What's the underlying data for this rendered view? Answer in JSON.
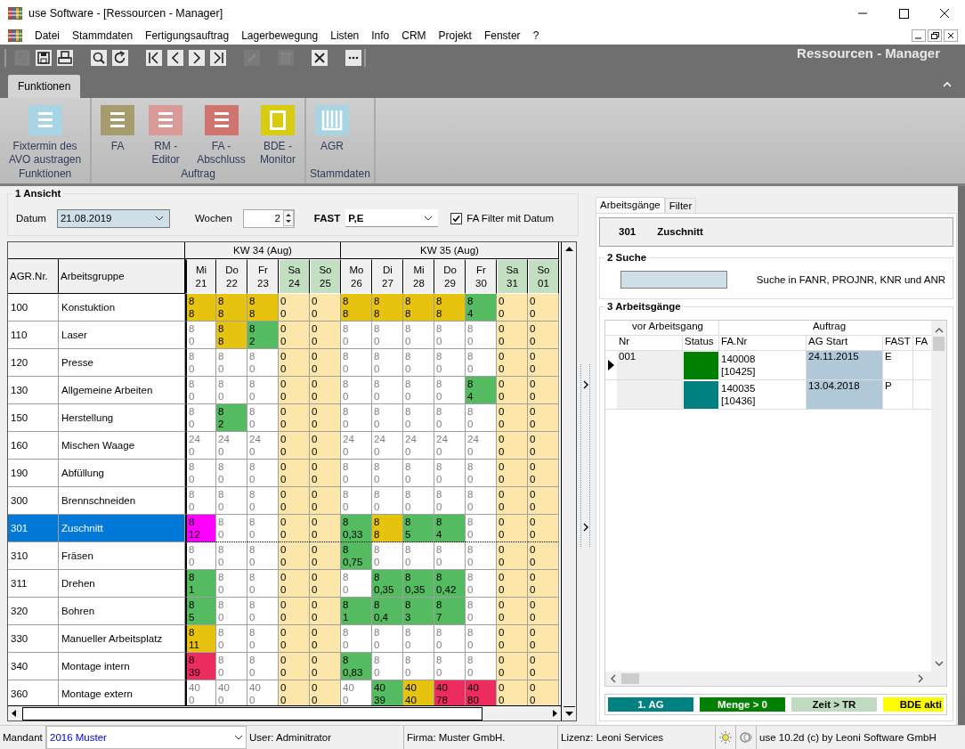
{
  "window": {
    "title": "use Software - [Ressourcen - Manager]"
  },
  "menu": [
    "Datei",
    "Stammdaten",
    "Fertigungsauftrag",
    "Lagerbewegung",
    "Listen",
    "Info",
    "CRM",
    "Projekt",
    "Fenster",
    "?"
  ],
  "toolbar": {
    "title": "Ressourcen - Manager",
    "buttons": [
      {
        "disabled": true
      },
      {
        "disabled": false
      },
      {
        "disabled": false
      },
      {
        "disabled": false
      },
      {
        "disabled": false
      },
      {
        "disabled": false
      },
      {
        "disabled": false
      },
      {
        "disabled": false
      },
      {
        "disabled": false
      },
      {
        "disabled": true
      },
      {
        "disabled": true
      },
      {
        "disabled": false
      },
      {
        "disabled": false
      }
    ]
  },
  "ribbon": {
    "tab": "Funktionen",
    "groups": [
      {
        "label": "Funktionen",
        "items": [
          {
            "label": "Fixtermin des\nAVO austragen",
            "kind": "list",
            "color": "#a8d4e4"
          }
        ]
      },
      {
        "label": "Auftrag",
        "items": [
          {
            "label": "FA",
            "kind": "list",
            "color": "#a79c6e"
          },
          {
            "label": "RM -\nEditor",
            "kind": "list",
            "color": "#d99a98"
          },
          {
            "label": "FA -\nAbschluss",
            "kind": "list",
            "color": "#d07470"
          },
          {
            "label": "BDE -\nMonitor",
            "kind": "frame",
            "color": "#d8cc10"
          }
        ]
      },
      {
        "label": "Stammdaten",
        "items": [
          {
            "label": "AGR",
            "kind": "comb",
            "color": "#a8d4e4"
          }
        ]
      }
    ]
  },
  "view": {
    "title": "1 Ansicht",
    "date_label": "Datum",
    "date": "21.08.2019",
    "weeks_label": "Wochen",
    "weeks": "2",
    "fast_label": "FAST",
    "fast": "P,E",
    "filter_label": "FA Filter mit Datum",
    "filter_checked": true
  },
  "grid": {
    "columns": [
      "AGR.Nr.",
      "Arbeitsgruppe"
    ],
    "weeks": [
      {
        "label": "KW 34 (Aug)",
        "days": [
          {
            "day": "Mi",
            "date": "21",
            "weekend": false
          },
          {
            "day": "Do",
            "date": "22",
            "weekend": false
          },
          {
            "day": "Fr",
            "date": "23",
            "weekend": false
          },
          {
            "day": "Sa",
            "date": "24",
            "weekend": true
          },
          {
            "day": "So",
            "date": "25",
            "weekend": true
          }
        ]
      },
      {
        "label": "KW 35 (Aug)",
        "days": [
          {
            "day": "Mo",
            "date": "26",
            "weekend": false
          },
          {
            "day": "Di",
            "date": "27",
            "weekend": false
          },
          {
            "day": "Mi",
            "date": "28",
            "weekend": false
          },
          {
            "day": "Do",
            "date": "29",
            "weekend": false
          },
          {
            "day": "Fr",
            "date": "30",
            "weekend": false
          },
          {
            "day": "Sa",
            "date": "31",
            "weekend": true
          },
          {
            "day": "So",
            "date": "01",
            "weekend": true
          }
        ]
      }
    ],
    "rows": [
      {
        "nr": "100",
        "name": "Konstuktion",
        "selected": false,
        "cells": [
          {
            "plan": "8",
            "used": "8",
            "color": "#e6c30f",
            "dimmed": false
          },
          {
            "plan": "8",
            "used": "8",
            "color": "#e6c30f",
            "dimmed": false
          },
          {
            "plan": "8",
            "used": "8",
            "color": "#e6c30f",
            "dimmed": false
          },
          {
            "plan": "0",
            "used": "0",
            "color": "#fde6a9",
            "dimmed": false
          },
          {
            "plan": "0",
            "used": "0",
            "color": "#fde6a9",
            "dimmed": false
          },
          {
            "plan": "8",
            "used": "8",
            "color": "#e6c30f",
            "dimmed": false
          },
          {
            "plan": "8",
            "used": "8",
            "color": "#e6c30f",
            "dimmed": false
          },
          {
            "plan": "8",
            "used": "8",
            "color": "#e6c30f",
            "dimmed": false
          },
          {
            "plan": "8",
            "used": "8",
            "color": "#e6c30f",
            "dimmed": false
          },
          {
            "plan": "8",
            "used": "4",
            "color": "#55bb60",
            "dimmed": false
          },
          {
            "plan": "0",
            "used": "0",
            "color": "#fde6a9",
            "dimmed": false
          },
          {
            "plan": "0",
            "used": "0",
            "color": "#fde6a9",
            "dimmed": false
          }
        ]
      },
      {
        "nr": "110",
        "name": "Laser",
        "selected": false,
        "cells": [
          {
            "plan": "8",
            "used": "0",
            "color": "#ffffff",
            "dimmed": true
          },
          {
            "plan": "8",
            "used": "8",
            "color": "#e6c30f",
            "dimmed": false
          },
          {
            "plan": "8",
            "used": "2",
            "color": "#55bb60",
            "dimmed": false
          },
          {
            "plan": "0",
            "used": "0",
            "color": "#fde6a9",
            "dimmed": false
          },
          {
            "plan": "0",
            "used": "0",
            "color": "#fde6a9",
            "dimmed": false
          },
          {
            "plan": "8",
            "used": "0",
            "color": "#ffffff",
            "dimmed": true
          },
          {
            "plan": "8",
            "used": "0",
            "color": "#ffffff",
            "dimmed": true
          },
          {
            "plan": "8",
            "used": "0",
            "color": "#ffffff",
            "dimmed": true
          },
          {
            "plan": "8",
            "used": "0",
            "color": "#ffffff",
            "dimmed": true
          },
          {
            "plan": "8",
            "used": "0",
            "color": "#ffffff",
            "dimmed": true
          },
          {
            "plan": "0",
            "used": "0",
            "color": "#fde6a9",
            "dimmed": false
          },
          {
            "plan": "0",
            "used": "0",
            "color": "#fde6a9",
            "dimmed": false
          }
        ]
      },
      {
        "nr": "120",
        "name": "Presse",
        "selected": false,
        "cells": [
          {
            "plan": "8",
            "used": "0",
            "color": "#ffffff",
            "dimmed": true
          },
          {
            "plan": "8",
            "used": "0",
            "color": "#ffffff",
            "dimmed": true
          },
          {
            "plan": "8",
            "used": "0",
            "color": "#ffffff",
            "dimmed": true
          },
          {
            "plan": "0",
            "used": "0",
            "color": "#fde6a9",
            "dimmed": false
          },
          {
            "plan": "0",
            "used": "0",
            "color": "#fde6a9",
            "dimmed": false
          },
          {
            "plan": "8",
            "used": "0",
            "color": "#ffffff",
            "dimmed": true
          },
          {
            "plan": "8",
            "used": "0",
            "color": "#ffffff",
            "dimmed": true
          },
          {
            "plan": "8",
            "used": "0",
            "color": "#ffffff",
            "dimmed": true
          },
          {
            "plan": "8",
            "used": "0",
            "color": "#ffffff",
            "dimmed": true
          },
          {
            "plan": "8",
            "used": "0",
            "color": "#ffffff",
            "dimmed": true
          },
          {
            "plan": "0",
            "used": "0",
            "color": "#fde6a9",
            "dimmed": false
          },
          {
            "plan": "0",
            "used": "0",
            "color": "#fde6a9",
            "dimmed": false
          }
        ]
      },
      {
        "nr": "130",
        "name": "Allgemeine Arbeiten",
        "selected": false,
        "cells": [
          {
            "plan": "8",
            "used": "0",
            "color": "#ffffff",
            "dimmed": true
          },
          {
            "plan": "8",
            "used": "0",
            "color": "#ffffff",
            "dimmed": true
          },
          {
            "plan": "8",
            "used": "0",
            "color": "#ffffff",
            "dimmed": true
          },
          {
            "plan": "0",
            "used": "0",
            "color": "#fde6a9",
            "dimmed": false
          },
          {
            "plan": "0",
            "used": "0",
            "color": "#fde6a9",
            "dimmed": false
          },
          {
            "plan": "8",
            "used": "0",
            "color": "#ffffff",
            "dimmed": true
          },
          {
            "plan": "8",
            "used": "0",
            "color": "#ffffff",
            "dimmed": true
          },
          {
            "plan": "8",
            "used": "0",
            "color": "#ffffff",
            "dimmed": true
          },
          {
            "plan": "8",
            "used": "0",
            "color": "#ffffff",
            "dimmed": true
          },
          {
            "plan": "8",
            "used": "4",
            "color": "#55bb60",
            "dimmed": false
          },
          {
            "plan": "0",
            "used": "0",
            "color": "#fde6a9",
            "dimmed": false
          },
          {
            "plan": "0",
            "used": "0",
            "color": "#fde6a9",
            "dimmed": false
          }
        ]
      },
      {
        "nr": "150",
        "name": "Herstellung",
        "selected": false,
        "cells": [
          {
            "plan": "8",
            "used": "0",
            "color": "#ffffff",
            "dimmed": true
          },
          {
            "plan": "8",
            "used": "2",
            "color": "#55bb60",
            "dimmed": false
          },
          {
            "plan": "8",
            "used": "0",
            "color": "#ffffff",
            "dimmed": true
          },
          {
            "plan": "0",
            "used": "0",
            "color": "#fde6a9",
            "dimmed": false
          },
          {
            "plan": "0",
            "used": "0",
            "color": "#fde6a9",
            "dimmed": false
          },
          {
            "plan": "8",
            "used": "0",
            "color": "#ffffff",
            "dimmed": true
          },
          {
            "plan": "8",
            "used": "0",
            "color": "#ffffff",
            "dimmed": true
          },
          {
            "plan": "8",
            "used": "0",
            "color": "#ffffff",
            "dimmed": true
          },
          {
            "plan": "8",
            "used": "0",
            "color": "#ffffff",
            "dimmed": true
          },
          {
            "plan": "8",
            "used": "0",
            "color": "#ffffff",
            "dimmed": true
          },
          {
            "plan": "0",
            "used": "0",
            "color": "#fde6a9",
            "dimmed": false
          },
          {
            "plan": "0",
            "used": "0",
            "color": "#fde6a9",
            "dimmed": false
          }
        ]
      },
      {
        "nr": "160",
        "name": "Mischen Waage",
        "selected": false,
        "cells": [
          {
            "plan": "24",
            "used": "0",
            "color": "#ffffff",
            "dimmed": true
          },
          {
            "plan": "24",
            "used": "0",
            "color": "#ffffff",
            "dimmed": true
          },
          {
            "plan": "24",
            "used": "0",
            "color": "#ffffff",
            "dimmed": true
          },
          {
            "plan": "0",
            "used": "0",
            "color": "#fde6a9",
            "dimmed": false
          },
          {
            "plan": "0",
            "used": "0",
            "color": "#fde6a9",
            "dimmed": false
          },
          {
            "plan": "24",
            "used": "0",
            "color": "#ffffff",
            "dimmed": true
          },
          {
            "plan": "24",
            "used": "0",
            "color": "#ffffff",
            "dimmed": true
          },
          {
            "plan": "24",
            "used": "0",
            "color": "#ffffff",
            "dimmed": true
          },
          {
            "plan": "24",
            "used": "0",
            "color": "#ffffff",
            "dimmed": true
          },
          {
            "plan": "24",
            "used": "0",
            "color": "#ffffff",
            "dimmed": true
          },
          {
            "plan": "0",
            "used": "0",
            "color": "#fde6a9",
            "dimmed": false
          },
          {
            "plan": "0",
            "used": "0",
            "color": "#fde6a9",
            "dimmed": false
          }
        ]
      },
      {
        "nr": "190",
        "name": "Abfüllung",
        "selected": false,
        "cells": [
          {
            "plan": "8",
            "used": "0",
            "color": "#ffffff",
            "dimmed": true
          },
          {
            "plan": "8",
            "used": "0",
            "color": "#ffffff",
            "dimmed": true
          },
          {
            "plan": "8",
            "used": "0",
            "color": "#ffffff",
            "dimmed": true
          },
          {
            "plan": "0",
            "used": "0",
            "color": "#fde6a9",
            "dimmed": false
          },
          {
            "plan": "0",
            "used": "0",
            "color": "#fde6a9",
            "dimmed": false
          },
          {
            "plan": "8",
            "used": "0",
            "color": "#ffffff",
            "dimmed": true
          },
          {
            "plan": "8",
            "used": "0",
            "color": "#ffffff",
            "dimmed": true
          },
          {
            "plan": "8",
            "used": "0",
            "color": "#ffffff",
            "dimmed": true
          },
          {
            "plan": "8",
            "used": "0",
            "color": "#ffffff",
            "dimmed": true
          },
          {
            "plan": "8",
            "used": "0",
            "color": "#ffffff",
            "dimmed": true
          },
          {
            "plan": "0",
            "used": "0",
            "color": "#fde6a9",
            "dimmed": false
          },
          {
            "plan": "0",
            "used": "0",
            "color": "#fde6a9",
            "dimmed": false
          }
        ]
      },
      {
        "nr": "300",
        "name": "Brennschneiden",
        "selected": false,
        "cells": [
          {
            "plan": "8",
            "used": "0",
            "color": "#ffffff",
            "dimmed": true
          },
          {
            "plan": "8",
            "used": "0",
            "color": "#ffffff",
            "dimmed": true
          },
          {
            "plan": "8",
            "used": "0",
            "color": "#ffffff",
            "dimmed": true
          },
          {
            "plan": "0",
            "used": "0",
            "color": "#fde6a9",
            "dimmed": false
          },
          {
            "plan": "0",
            "used": "0",
            "color": "#fde6a9",
            "dimmed": false
          },
          {
            "plan": "8",
            "used": "0",
            "color": "#ffffff",
            "dimmed": true
          },
          {
            "plan": "8",
            "used": "0",
            "color": "#ffffff",
            "dimmed": true
          },
          {
            "plan": "8",
            "used": "0",
            "color": "#ffffff",
            "dimmed": true
          },
          {
            "plan": "8",
            "used": "0",
            "color": "#ffffff",
            "dimmed": true
          },
          {
            "plan": "8",
            "used": "0",
            "color": "#ffffff",
            "dimmed": true
          },
          {
            "plan": "0",
            "used": "0",
            "color": "#fde6a9",
            "dimmed": false
          },
          {
            "plan": "0",
            "used": "0",
            "color": "#fde6a9",
            "dimmed": false
          }
        ]
      },
      {
        "nr": "301",
        "name": "Zuschnitt",
        "selected": true,
        "cells": [
          {
            "plan": "8",
            "used": "12",
            "color": "#ff00ff",
            "dimmed": false
          },
          {
            "plan": "8",
            "used": "0",
            "color": "#ffffff",
            "dimmed": true
          },
          {
            "plan": "8",
            "used": "0",
            "color": "#ffffff",
            "dimmed": true
          },
          {
            "plan": "0",
            "used": "0",
            "color": "#fde6a9",
            "dimmed": false
          },
          {
            "plan": "0",
            "used": "0",
            "color": "#fde6a9",
            "dimmed": false
          },
          {
            "plan": "8",
            "used": "0,33",
            "color": "#55bb60",
            "dimmed": false
          },
          {
            "plan": "8",
            "used": "8",
            "color": "#e6c30f",
            "dimmed": false
          },
          {
            "plan": "8",
            "used": "5",
            "color": "#55bb60",
            "dimmed": false
          },
          {
            "plan": "8",
            "used": "4",
            "color": "#55bb60",
            "dimmed": false
          },
          {
            "plan": "8",
            "used": "0",
            "color": "#ffffff",
            "dimmed": true
          },
          {
            "plan": "0",
            "used": "0",
            "color": "#fde6a9",
            "dimmed": false
          },
          {
            "plan": "0",
            "used": "0",
            "color": "#fde6a9",
            "dimmed": false
          }
        ]
      },
      {
        "nr": "310",
        "name": "Fräsen",
        "selected": false,
        "cells": [
          {
            "plan": "8",
            "used": "0",
            "color": "#ffffff",
            "dimmed": true
          },
          {
            "plan": "8",
            "used": "0",
            "color": "#ffffff",
            "dimmed": true
          },
          {
            "plan": "8",
            "used": "0",
            "color": "#ffffff",
            "dimmed": true
          },
          {
            "plan": "0",
            "used": "0",
            "color": "#fde6a9",
            "dimmed": false
          },
          {
            "plan": "0",
            "used": "0",
            "color": "#fde6a9",
            "dimmed": false
          },
          {
            "plan": "8",
            "used": "0,75",
            "color": "#55bb60",
            "dimmed": false
          },
          {
            "plan": "8",
            "used": "0",
            "color": "#ffffff",
            "dimmed": true
          },
          {
            "plan": "8",
            "used": "0",
            "color": "#ffffff",
            "dimmed": true
          },
          {
            "plan": "8",
            "used": "0",
            "color": "#ffffff",
            "dimmed": true
          },
          {
            "plan": "8",
            "used": "0",
            "color": "#ffffff",
            "dimmed": true
          },
          {
            "plan": "0",
            "used": "0",
            "color": "#fde6a9",
            "dimmed": false
          },
          {
            "plan": "0",
            "used": "0",
            "color": "#fde6a9",
            "dimmed": false
          }
        ]
      },
      {
        "nr": "311",
        "name": "Drehen",
        "selected": false,
        "cells": [
          {
            "plan": "8",
            "used": "1",
            "color": "#55bb60",
            "dimmed": false
          },
          {
            "plan": "8",
            "used": "0",
            "color": "#ffffff",
            "dimmed": true
          },
          {
            "plan": "8",
            "used": "0",
            "color": "#ffffff",
            "dimmed": true
          },
          {
            "plan": "0",
            "used": "0",
            "color": "#fde6a9",
            "dimmed": false
          },
          {
            "plan": "0",
            "used": "0",
            "color": "#fde6a9",
            "dimmed": false
          },
          {
            "plan": "8",
            "used": "0",
            "color": "#ffffff",
            "dimmed": true
          },
          {
            "plan": "8",
            "used": "0,35",
            "color": "#55bb60",
            "dimmed": false
          },
          {
            "plan": "8",
            "used": "0,35",
            "color": "#55bb60",
            "dimmed": false
          },
          {
            "plan": "8",
            "used": "0,42",
            "color": "#55bb60",
            "dimmed": false
          },
          {
            "plan": "8",
            "used": "0",
            "color": "#ffffff",
            "dimmed": true
          },
          {
            "plan": "0",
            "used": "0",
            "color": "#fde6a9",
            "dimmed": false
          },
          {
            "plan": "0",
            "used": "0",
            "color": "#fde6a9",
            "dimmed": false
          }
        ]
      },
      {
        "nr": "320",
        "name": "Bohren",
        "selected": false,
        "cells": [
          {
            "plan": "8",
            "used": "5",
            "color": "#55bb60",
            "dimmed": false
          },
          {
            "plan": "8",
            "used": "0",
            "color": "#ffffff",
            "dimmed": true
          },
          {
            "plan": "8",
            "used": "0",
            "color": "#ffffff",
            "dimmed": true
          },
          {
            "plan": "0",
            "used": "0",
            "color": "#fde6a9",
            "dimmed": false
          },
          {
            "plan": "0",
            "used": "0",
            "color": "#fde6a9",
            "dimmed": false
          },
          {
            "plan": "8",
            "used": "1",
            "color": "#55bb60",
            "dimmed": false
          },
          {
            "plan": "8",
            "used": "0,4",
            "color": "#55bb60",
            "dimmed": false
          },
          {
            "plan": "8",
            "used": "3",
            "color": "#55bb60",
            "dimmed": false
          },
          {
            "plan": "8",
            "used": "7",
            "color": "#55bb60",
            "dimmed": false
          },
          {
            "plan": "8",
            "used": "0",
            "color": "#ffffff",
            "dimmed": true
          },
          {
            "plan": "0",
            "used": "0",
            "color": "#fde6a9",
            "dimmed": false
          },
          {
            "plan": "0",
            "used": "0",
            "color": "#fde6a9",
            "dimmed": false
          }
        ]
      },
      {
        "nr": "330",
        "name": "Manueller Arbeitsplatz",
        "selected": false,
        "cells": [
          {
            "plan": "8",
            "used": "11",
            "color": "#e6c30f",
            "dimmed": false
          },
          {
            "plan": "8",
            "used": "0",
            "color": "#ffffff",
            "dimmed": true
          },
          {
            "plan": "8",
            "used": "0",
            "color": "#ffffff",
            "dimmed": true
          },
          {
            "plan": "0",
            "used": "0",
            "color": "#fde6a9",
            "dimmed": false
          },
          {
            "plan": "0",
            "used": "0",
            "color": "#fde6a9",
            "dimmed": false
          },
          {
            "plan": "8",
            "used": "0",
            "color": "#ffffff",
            "dimmed": true
          },
          {
            "plan": "8",
            "used": "0",
            "color": "#ffffff",
            "dimmed": true
          },
          {
            "plan": "8",
            "used": "0",
            "color": "#ffffff",
            "dimmed": true
          },
          {
            "plan": "8",
            "used": "0",
            "color": "#ffffff",
            "dimmed": true
          },
          {
            "plan": "8",
            "used": "0",
            "color": "#ffffff",
            "dimmed": true
          },
          {
            "plan": "0",
            "used": "0",
            "color": "#fde6a9",
            "dimmed": false
          },
          {
            "plan": "0",
            "used": "0",
            "color": "#fde6a9",
            "dimmed": false
          }
        ]
      },
      {
        "nr": "340",
        "name": "Montage intern",
        "selected": false,
        "cells": [
          {
            "plan": "8",
            "used": "39",
            "color": "#ec2b5f",
            "dimmed": false
          },
          {
            "plan": "8",
            "used": "0",
            "color": "#ffffff",
            "dimmed": true
          },
          {
            "plan": "8",
            "used": "0",
            "color": "#ffffff",
            "dimmed": true
          },
          {
            "plan": "0",
            "used": "0",
            "color": "#fde6a9",
            "dimmed": false
          },
          {
            "plan": "0",
            "used": "0",
            "color": "#fde6a9",
            "dimmed": false
          },
          {
            "plan": "8",
            "used": "0,83",
            "color": "#55bb60",
            "dimmed": false
          },
          {
            "plan": "8",
            "used": "0",
            "color": "#ffffff",
            "dimmed": true
          },
          {
            "plan": "8",
            "used": "0",
            "color": "#ffffff",
            "dimmed": true
          },
          {
            "plan": "8",
            "used": "0",
            "color": "#ffffff",
            "dimmed": true
          },
          {
            "plan": "8",
            "used": "0",
            "color": "#ffffff",
            "dimmed": true
          },
          {
            "plan": "0",
            "used": "0",
            "color": "#fde6a9",
            "dimmed": false
          },
          {
            "plan": "0",
            "used": "0",
            "color": "#fde6a9",
            "dimmed": false
          }
        ]
      },
      {
        "nr": "360",
        "name": "Montage extern",
        "selected": false,
        "cells": [
          {
            "plan": "40",
            "used": "0",
            "color": "#ffffff",
            "dimmed": true
          },
          {
            "plan": "40",
            "used": "0",
            "color": "#ffffff",
            "dimmed": true
          },
          {
            "plan": "40",
            "used": "0",
            "color": "#ffffff",
            "dimmed": true
          },
          {
            "plan": "0",
            "used": "0",
            "color": "#fde6a9",
            "dimmed": false
          },
          {
            "plan": "0",
            "used": "0",
            "color": "#fde6a9",
            "dimmed": false
          },
          {
            "plan": "40",
            "used": "0",
            "color": "#ffffff",
            "dimmed": true
          },
          {
            "plan": "40",
            "used": "39",
            "color": "#55bb60",
            "dimmed": false
          },
          {
            "plan": "40",
            "used": "40",
            "color": "#e6c30f",
            "dimmed": false
          },
          {
            "plan": "40",
            "used": "78",
            "color": "#ec2b5f",
            "dimmed": false
          },
          {
            "plan": "40",
            "used": "80",
            "color": "#ec2b5f",
            "dimmed": false
          },
          {
            "plan": "0",
            "used": "0",
            "color": "#fde6a9",
            "dimmed": false
          },
          {
            "plan": "0",
            "used": "0",
            "color": "#fde6a9",
            "dimmed": false
          }
        ]
      }
    ]
  },
  "side": {
    "tabs": [
      {
        "label": "Arbeitsgänge",
        "selected": true
      },
      {
        "label": "Filter",
        "selected": false
      }
    ],
    "header": {
      "nr": "301",
      "name": "Zuschnitt"
    },
    "search": {
      "title": "2 Suche",
      "hint": "Suche in FANR, PROJNR, KNR und ANR"
    },
    "operations": {
      "title": "3 Arbeitsgänge",
      "groups": [
        "vor Arbeitsgang",
        "Auftrag"
      ],
      "columns": [
        "Nr",
        "Status",
        "FA.Nr",
        "AG Start",
        "FAST",
        "FA"
      ],
      "rows": [
        {
          "nr": "001",
          "color": "#008000",
          "fa": "140008\n[10425]",
          "start": "24.11.2015",
          "fast": "E",
          "selected": true
        },
        {
          "color": "#008080",
          "fa": "140035\n[10436]",
          "start": "13.04.2018",
          "fast": "P",
          "selected": false
        }
      ]
    },
    "legend": [
      {
        "label": "1. AG",
        "color": "#008080"
      },
      {
        "label": "Menge > 0",
        "color": "#008000"
      },
      {
        "label": "Zeit > TR",
        "color": "#c0dcc0"
      },
      {
        "label": "BDE akti",
        "color": "#ffff00"
      }
    ]
  },
  "status_bar": {
    "mandant_label": "Mandant",
    "mandant": "2016 Muster",
    "user": "User: Adminitrator",
    "firma": "Firma: Muster GmbH.",
    "lizenz": "Lizenz: Leoni Services",
    "version": "use 10.2d (c) by Leoni Software GmbH"
  }
}
